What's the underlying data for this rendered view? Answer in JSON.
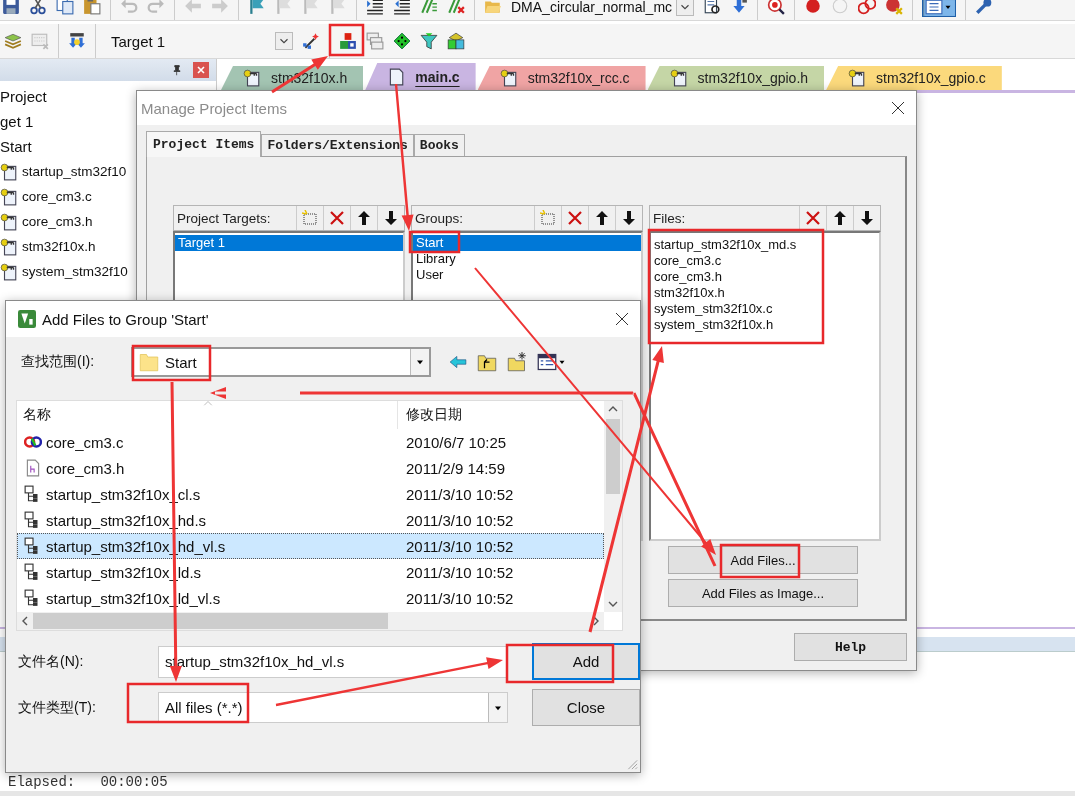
{
  "toolbar": {
    "project_select": "DMA_circular_normal_mc",
    "target_select": "Target 1",
    "window_button_active": true
  },
  "project_panel": {
    "tree": [
      {
        "label": "Project",
        "children": [
          {
            "label": "get 1",
            "children": [
              {
                "label": "Start",
                "children": [
                  {
                    "label": "startup_stm32f10",
                    "locked": true
                  },
                  {
                    "label": "core_cm3.c",
                    "locked": true
                  },
                  {
                    "label": "core_cm3.h",
                    "locked": true
                  },
                  {
                    "label": "stm32f10x.h",
                    "locked": true
                  },
                  {
                    "label": "system_stm32f10",
                    "locked": true
                  }
                ]
              }
            ]
          }
        ]
      }
    ]
  },
  "editor_tabs": [
    {
      "label": "stm32f10x.h",
      "color": "#a3c4b2",
      "selected": false,
      "locked": true
    },
    {
      "label": "main.c",
      "color": "#c9b5e2",
      "selected": true,
      "locked": false
    },
    {
      "label": "stm32f10x_rcc.c",
      "color": "#f0a4a4",
      "selected": false,
      "locked": true
    },
    {
      "label": "stm32f10x_gpio.h",
      "color": "#c5d6a6",
      "selected": false,
      "locked": true
    },
    {
      "label": "stm32f10x_gpio.c",
      "color": "#fbd97c",
      "selected": false,
      "locked": true
    }
  ],
  "manage_dialog": {
    "title": "Manage Project Items",
    "tabs": [
      {
        "label": "Project Items",
        "selected": true
      },
      {
        "label": "Folders/Extensions",
        "selected": false
      },
      {
        "label": "Books",
        "selected": false
      }
    ],
    "targets": {
      "label": "Project Targets:",
      "items": [
        {
          "label": "Target 1",
          "selected": true
        }
      ]
    },
    "groups": {
      "label": "Groups:",
      "items": [
        {
          "label": "Start",
          "selected": true
        },
        {
          "label": "Library",
          "selected": false
        },
        {
          "label": "User",
          "selected": false
        }
      ]
    },
    "files": {
      "label": "Files:",
      "items": [
        {
          "label": "startup_stm32f10x_md.s",
          "selected": false
        },
        {
          "label": "core_cm3.c",
          "selected": false
        },
        {
          "label": "core_cm3.h",
          "selected": false
        },
        {
          "label": "stm32f10x.h",
          "selected": false
        },
        {
          "label": "system_stm32f10x.c",
          "selected": false
        },
        {
          "label": "system_stm32f10x.h",
          "selected": false
        }
      ]
    },
    "add_files_button": "Add Files...",
    "add_image_button": "Add Files as Image...",
    "help_button": "Help"
  },
  "add_dialog": {
    "title": "Add Files to Group 'Start'",
    "look_in_label": "查找范围(I):",
    "look_in_value": "Start",
    "columns": [
      "名称",
      "修改日期"
    ],
    "rows": [
      {
        "name": "core_cm3.c",
        "date": "2010/6/7 10:25",
        "kind": "c",
        "selected": false
      },
      {
        "name": "core_cm3.h",
        "date": "2011/2/9 14:59",
        "kind": "h",
        "selected": false
      },
      {
        "name": "startup_stm32f10x_cl.s",
        "date": "2011/3/10 10:52",
        "kind": "s",
        "selected": false
      },
      {
        "name": "startup_stm32f10x_hd.s",
        "date": "2011/3/10 10:52",
        "kind": "s",
        "selected": false
      },
      {
        "name": "startup_stm32f10x_hd_vl.s",
        "date": "2011/3/10 10:52",
        "kind": "s",
        "selected": true
      },
      {
        "name": "startup_stm32f10x_ld.s",
        "date": "2011/3/10 10:52",
        "kind": "s",
        "selected": false
      },
      {
        "name": "startup_stm32f10x_ld_vl.s",
        "date": "2011/3/10 10:52",
        "kind": "s",
        "selected": false
      }
    ],
    "filename_label": "文件名(N):",
    "filename_value": "startup_stm32f10x_hd_vl.s",
    "filetype_label": "文件类型(T):",
    "filetype_value": "All files (*.*)",
    "add_button": "Add",
    "close_button": "Close"
  },
  "output": {
    "line": "Elapsed:   00:00:05"
  }
}
